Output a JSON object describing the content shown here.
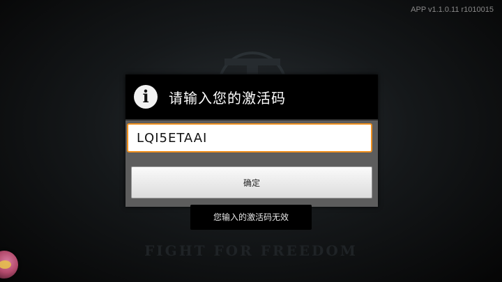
{
  "app": {
    "version_text": "APP v1.1.0.11 r1010015",
    "tagline": "FIGHT FOR FREEDOM"
  },
  "dialog": {
    "icon": "info-icon",
    "icon_glyph": "i",
    "title": "请输入您的激活码",
    "input": {
      "value": "LQI5ETAAI",
      "placeholder": ""
    },
    "confirm_label": "确定"
  },
  "toast": {
    "message": "您输入的激活码无效"
  },
  "colors": {
    "input_border": "#f0901e",
    "dialog_bg": "#5d5d5d",
    "header_bg": "#000000"
  }
}
